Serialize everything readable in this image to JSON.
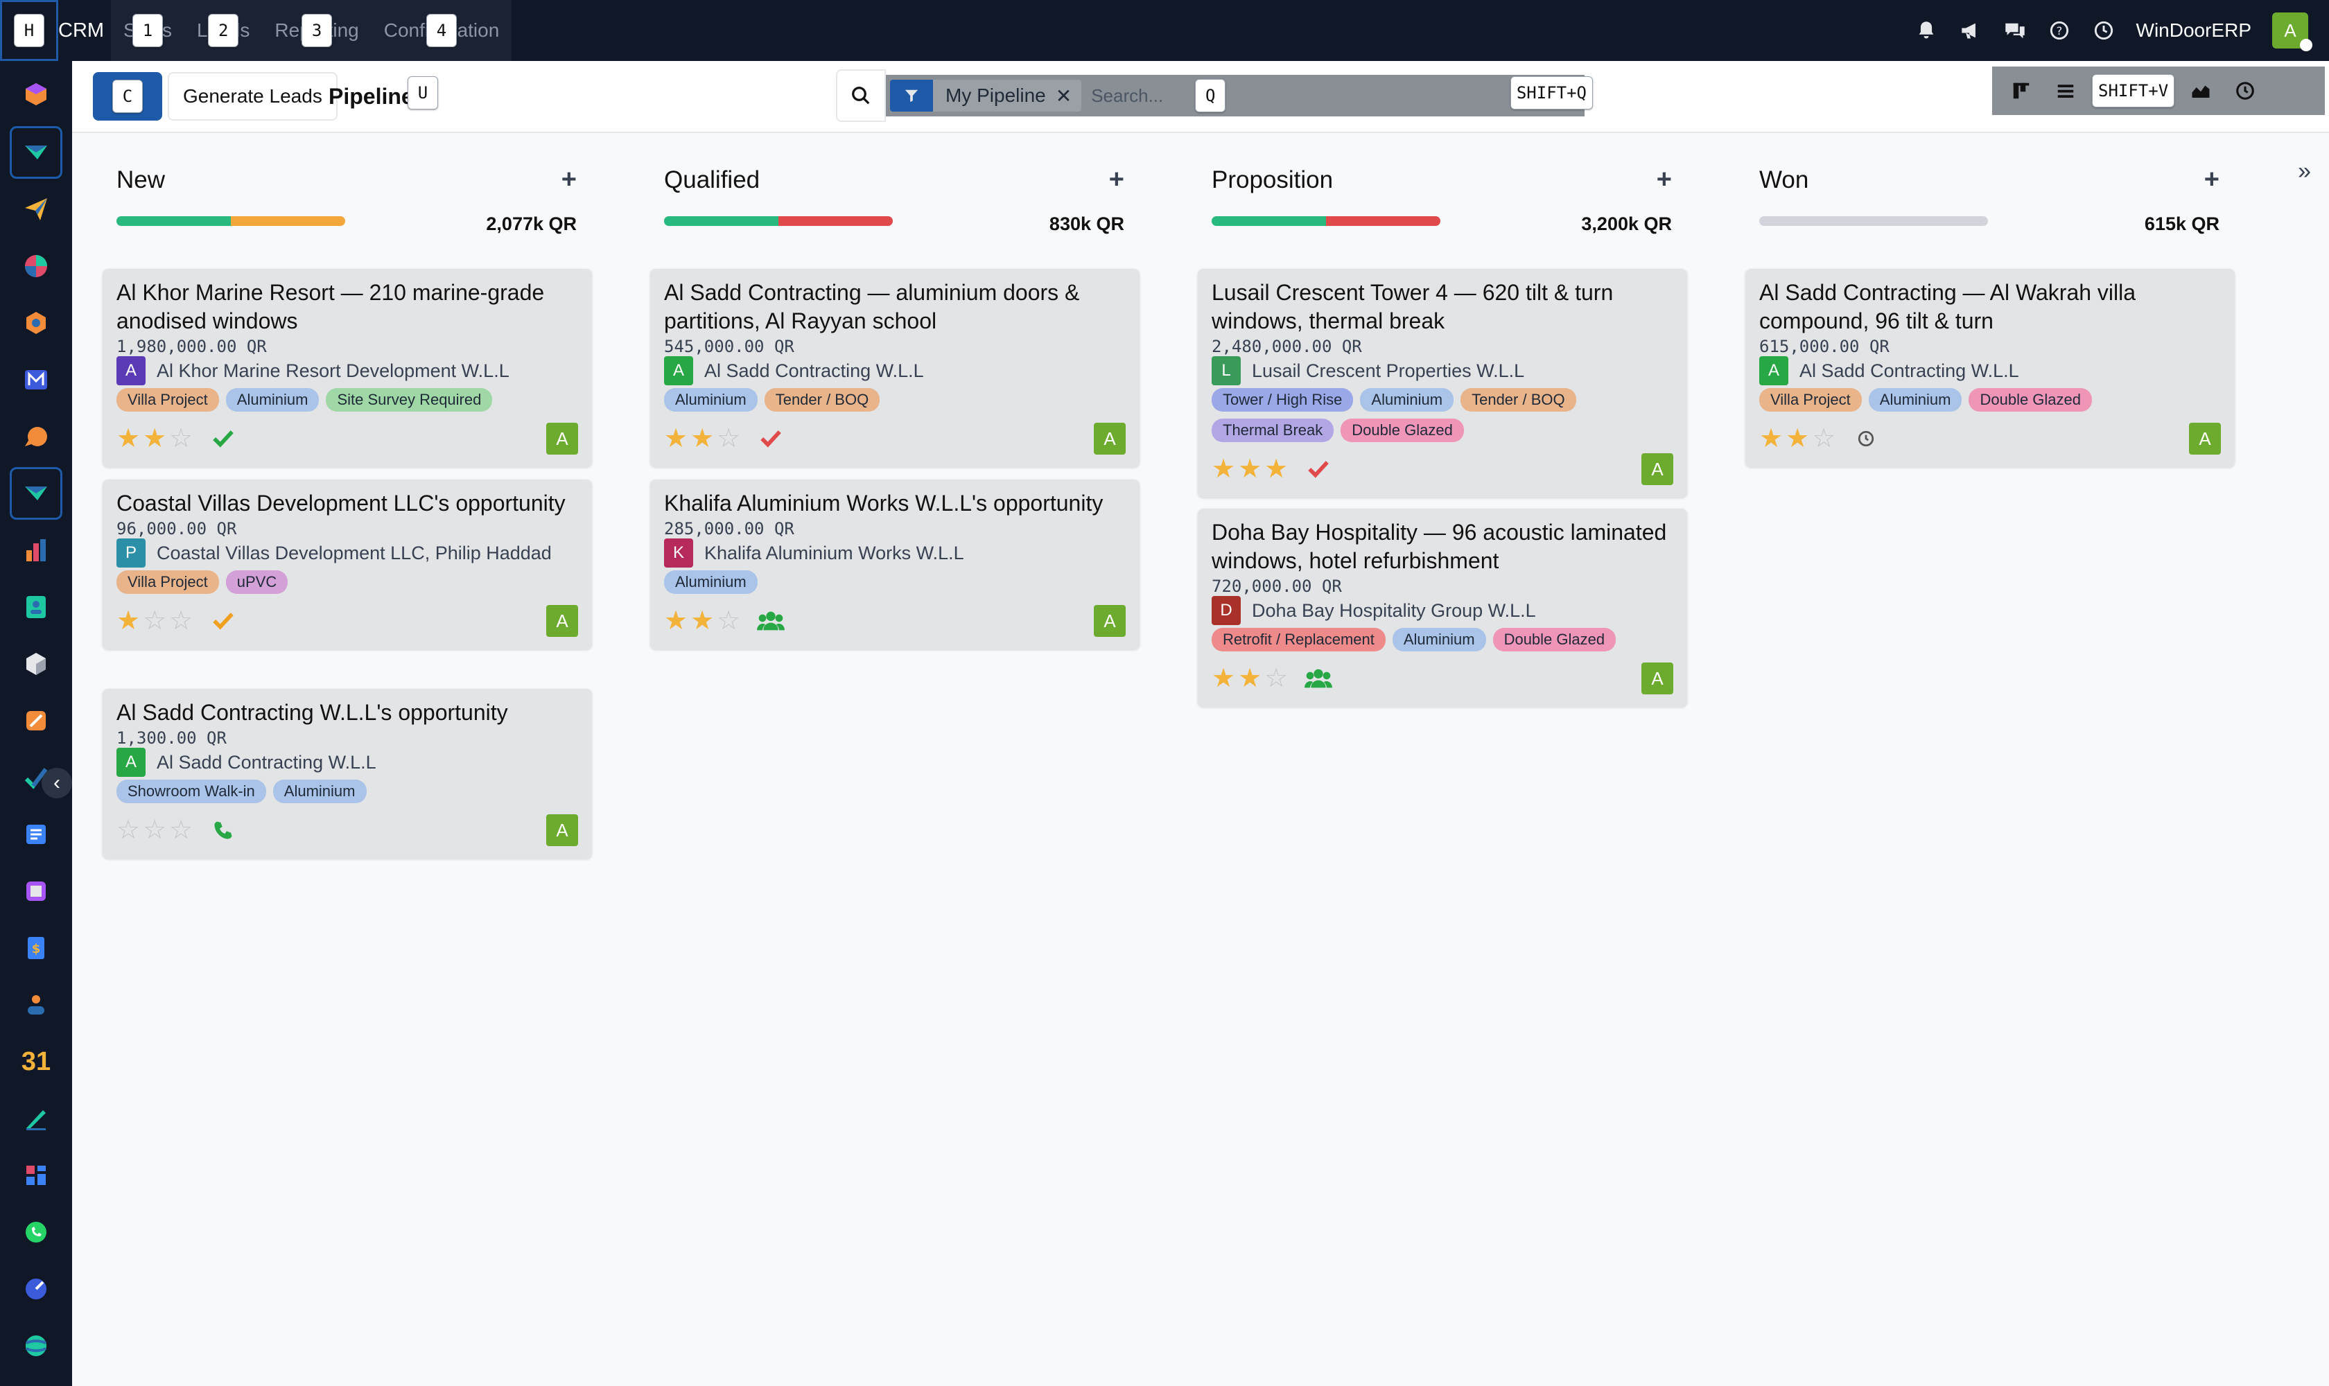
{
  "navbar": {
    "home_key": "H",
    "app_name": "CRM",
    "menus": [
      {
        "label": "Sales",
        "key": "1"
      },
      {
        "label": "Leads",
        "key": "2"
      },
      {
        "label": "Reporting",
        "key": "3"
      },
      {
        "label": "Configuration",
        "key": "4"
      }
    ],
    "company": "WinDoorERP",
    "user_initial": "A"
  },
  "control": {
    "new_key": "C",
    "generate_label": "Generate Leads",
    "title": "Pipeline",
    "title_key": "U",
    "facet_label": "My Pipeline",
    "search_placeholder": "Search...",
    "search_key": "Q",
    "search_shortcut": "SHIFT+Q",
    "view_shortcut": "SHIFT+V"
  },
  "colors": {
    "green": "#28b97e",
    "orange": "#f3a73a",
    "red": "#e04a4a",
    "grey": "#d1d5db",
    "star": "#f3b23a",
    "accent": "#1e5aa8"
  },
  "columns": [
    {
      "name": "New",
      "total": "2,077k QR",
      "progress": [
        {
          "color": "#28b97e",
          "pct": 50
        },
        {
          "color": "#f3a73a",
          "pct": 50
        }
      ],
      "cards": [
        {
          "title": "Al Khor Marine Resort — 210 marine-grade anodised windows",
          "amount": "1,980,000.00 QR",
          "partner_initial": "A",
          "partner_color": "#5b3ab5",
          "partner": "Al Khor Marine Resort Development W.L.L",
          "tags": [
            {
              "label": "Villa Project",
              "color": "#e9b48a"
            },
            {
              "label": "Aluminium",
              "color": "#a9c4e8"
            },
            {
              "label": "Site Survey Required",
              "color": "#9fd8a6"
            }
          ],
          "stars": 2,
          "activity": "check-icon",
          "activity_color": "#28a745",
          "assignee": "A"
        },
        {
          "title": "Coastal Villas Development LLC's opportunity",
          "amount": "96,000.00 QR",
          "partner_initial": "P",
          "partner_color": "#2b8fa8",
          "partner": "Coastal Villas Development LLC, Philip Haddad",
          "tags": [
            {
              "label": "Villa Project",
              "color": "#e9b48a"
            },
            {
              "label": "uPVC",
              "color": "#d3a0d8"
            }
          ],
          "stars": 1,
          "activity": "check-icon",
          "activity_color": "#f0a020",
          "assignee": "A"
        },
        {
          "title": "Al Sadd Contracting W.L.L's opportunity",
          "amount": "1,300.00 QR",
          "partner_initial": "A",
          "partner_color": "#28a745",
          "partner": "Al Sadd Contracting W.L.L",
          "tags": [
            {
              "label": "Showroom Walk-in",
              "color": "#a9c4e8"
            },
            {
              "label": "Aluminium",
              "color": "#a9c4e8"
            }
          ],
          "stars": 0,
          "activity": "phone-icon",
          "activity_color": "#28a745",
          "assignee": "A"
        }
      ]
    },
    {
      "name": "Qualified",
      "total": "830k QR",
      "progress": [
        {
          "color": "#28b97e",
          "pct": 50
        },
        {
          "color": "#e04a4a",
          "pct": 50
        }
      ],
      "cards": [
        {
          "title": "Al Sadd Contracting — aluminium doors & partitions, Al Rayyan school",
          "amount": "545,000.00 QR",
          "partner_initial": "A",
          "partner_color": "#28a745",
          "partner": "Al Sadd Contracting W.L.L",
          "tags": [
            {
              "label": "Aluminium",
              "color": "#a9c4e8"
            },
            {
              "label": "Tender / BOQ",
              "color": "#e9b48a"
            }
          ],
          "stars": 2,
          "activity": "check-icon",
          "activity_color": "#e04a4a",
          "assignee": "A"
        },
        {
          "title": "Khalifa Aluminium Works W.L.L's opportunity",
          "amount": "285,000.00 QR",
          "partner_initial": "K",
          "partner_color": "#b52a5a",
          "partner": "Khalifa Aluminium Works W.L.L",
          "tags": [
            {
              "label": "Aluminium",
              "color": "#a9c4e8"
            }
          ],
          "stars": 2,
          "activity": "users-icon",
          "activity_color": "#28a745",
          "assignee": "A"
        }
      ]
    },
    {
      "name": "Proposition",
      "total": "3,200k QR",
      "progress": [
        {
          "color": "#28b97e",
          "pct": 50
        },
        {
          "color": "#e04a4a",
          "pct": 50
        }
      ],
      "cards": [
        {
          "title": "Lusail Crescent Tower 4 — 620 tilt & turn windows, thermal break",
          "amount": "2,480,000.00 QR",
          "partner_initial": "L",
          "partner_color": "#3a9a5a",
          "partner": "Lusail Crescent Properties W.L.L",
          "tags": [
            {
              "label": "Tower / High Rise",
              "color": "#9aa8e8"
            },
            {
              "label": "Aluminium",
              "color": "#a9c4e8"
            },
            {
              "label": "Tender / BOQ",
              "color": "#e9b48a"
            },
            {
              "label": "Thermal Break",
              "color": "#b2a6e4"
            },
            {
              "label": "Double Glazed",
              "color": "#ee95b8"
            }
          ],
          "stars": 3,
          "activity": "check-icon",
          "activity_color": "#e04a4a",
          "assignee": "A"
        },
        {
          "title": "Doha Bay Hospitality — 96 acoustic laminated windows, hotel refurbishment",
          "amount": "720,000.00 QR",
          "partner_initial": "D",
          "partner_color": "#a8322a",
          "partner": "Doha Bay Hospitality Group W.L.L",
          "tags": [
            {
              "label": "Retrofit / Replacement",
              "color": "#ee8a8a"
            },
            {
              "label": "Aluminium",
              "color": "#a9c4e8"
            },
            {
              "label": "Double Glazed",
              "color": "#ee95b8"
            }
          ],
          "stars": 2,
          "activity": "users-icon",
          "activity_color": "#28a745",
          "assignee": "A"
        }
      ]
    },
    {
      "name": "Won",
      "total": "615k QR",
      "progress": [],
      "cards": [
        {
          "title": "Al Sadd Contracting — Al Wakrah villa compound, 96 tilt & turn",
          "amount": "615,000.00 QR",
          "partner_initial": "A",
          "partner_color": "#28a745",
          "partner": "Al Sadd Contracting W.L.L",
          "tags": [
            {
              "label": "Villa Project",
              "color": "#e9b48a"
            },
            {
              "label": "Aluminium",
              "color": "#a9c4e8"
            },
            {
              "label": "Double Glazed",
              "color": "#ee95b8"
            }
          ],
          "stars": 2,
          "activity": "clock-icon",
          "activity_color": "#555555",
          "assignee": "A"
        }
      ]
    }
  ]
}
